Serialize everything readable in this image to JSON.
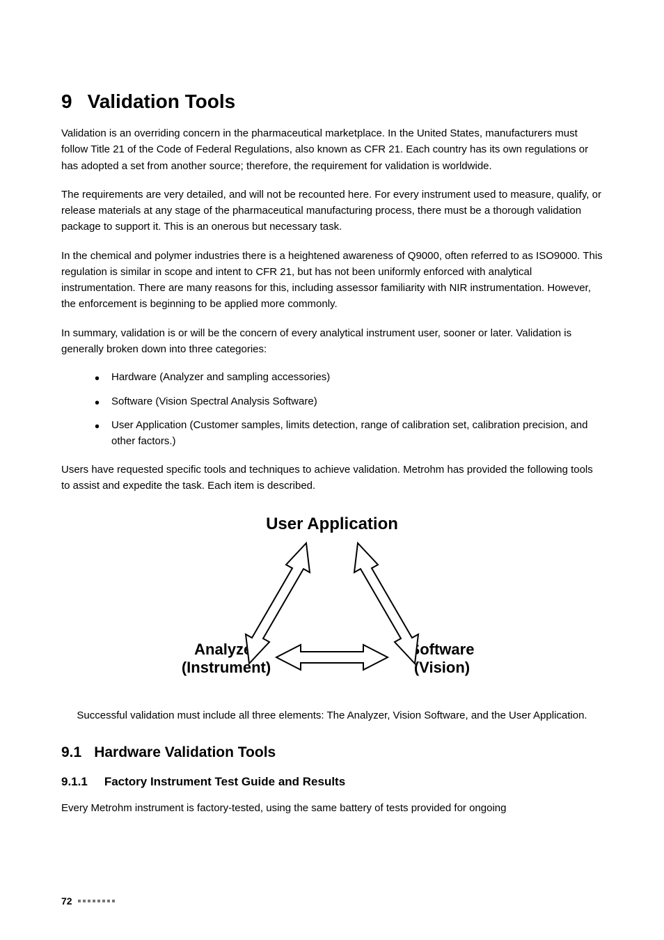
{
  "heading": {
    "number": "9",
    "title": "Validation Tools"
  },
  "paragraphs": {
    "p1": "Validation is an overriding concern in the pharmaceutical marketplace. In the United States, manufacturers must follow Title 21 of the Code of Federal Regulations, also known as CFR 21. Each country has its own regulations or has adopted a set from another source; therefore, the requirement for validation is worldwide.",
    "p2": "The requirements are very detailed, and will not be recounted here. For every instrument used to measure, qualify, or release materials at any stage of the pharmaceutical manufacturing process, there must be a thorough validation package to support it. This is an onerous but necessary task.",
    "p3": "In the chemical and polymer industries there is a heightened awareness of Q9000, often referred to as ISO9000. This regulation is similar in scope and intent to CFR 21, but has not been uniformly enforced with analytical instrumentation. There are many reasons for this, including assessor familiarity with NIR instrumentation. However, the enforcement is beginning to be applied more commonly.",
    "p4": "In summary, validation is or will be the concern of every analytical instrument user, sooner or later. Validation is generally broken down into three categories:",
    "p5": "Users have requested specific tools and techniques to achieve validation. Metrohm has provided the following tools to assist and expedite the task. Each item is described."
  },
  "bullets": [
    "Hardware (Analyzer and sampling accessories)",
    "Software (Vision Spectral Analysis Software)",
    "User Application (Customer samples, limits detection, range of calibration set, calibration precision, and other factors.)"
  ],
  "diagram": {
    "top": "User Application",
    "left1": "Analyzer",
    "left2": "(Instrument)",
    "right1": "Software",
    "right2": "(Vision)"
  },
  "caption": "Successful validation must include all three elements: The Analyzer, Vision Software, and the User Application.",
  "h2": {
    "number": "9.1",
    "title": "Hardware Validation Tools"
  },
  "h3": {
    "number": "9.1.1",
    "title": "Factory Instrument Test Guide and Results"
  },
  "paragraphs2": {
    "p6": "Every Metrohm instrument is factory-tested, using the same battery of tests provided for ongoing"
  },
  "footer": {
    "page": "72"
  }
}
